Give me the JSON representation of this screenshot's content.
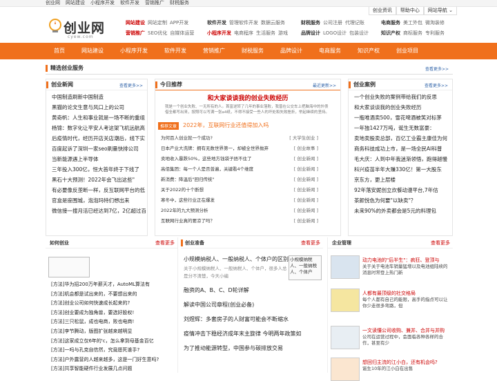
{
  "topbar": {
    "links": [
      "创业网",
      "网站建设",
      "小程序开发",
      "软件开发",
      "营销推广",
      "财税服务"
    ]
  },
  "topright": {
    "items": [
      "创业资讯",
      "帮助中心",
      "网站导航 ⌄"
    ]
  },
  "logo": {
    "text": "创业网",
    "sub": "cyew.com"
  },
  "navgrid": [
    {
      "rows": [
        {
          "hd": "网站建设",
          "subs": [
            "网站定制",
            "APP开发"
          ]
        },
        {
          "hd": "营销推广",
          "subs": [
            "SEO优化",
            "自媒体运营"
          ]
        }
      ]
    },
    {
      "rows": [
        {
          "hd": "软件开发",
          "subs": [
            "管理软件开发",
            "数据云服务"
          ]
        },
        {
          "hd": "小程序开发",
          "subs": [
            "电商程序",
            "生活服务",
            "游戏"
          ]
        }
      ]
    },
    {
      "rows": [
        {
          "hd": "财税服务",
          "subs": [
            "公司注册",
            "代理记账"
          ]
        },
        {
          "hd": "品牌设计",
          "subs": [
            "LOGO设计",
            "包装设计"
          ]
        }
      ]
    },
    {
      "rows": [
        {
          "hd": "电商服务",
          "subs": [
            "美工外包",
            "微淘装修"
          ]
        },
        {
          "hd": "知识产权",
          "subs": [
            "商标服务",
            "专利服务"
          ]
        }
      ]
    }
  ],
  "mainnav": [
    "首页",
    "网站建设",
    "小程序开发",
    "软件开发",
    "营销推广",
    "财税服务",
    "品牌设计",
    "电商服务",
    "知识产权",
    "创业项目"
  ],
  "section": {
    "title": "精选创业服务",
    "more": "查看更多>>"
  },
  "news": {
    "title": "创业新闻",
    "more": "查看更多>>",
    "items": [
      "中国制造刷新中国制造",
      "黑猫的论文生意与风口上的公司",
      "黄奇帆：人生和事业就是一场不断的重组",
      "杨锦：数字化让平安人考这架飞机远航高",
      "后疫情时代，经历开店关店潮后，线下实",
      "百度起诉了深圳一家seo刷量快排公司",
      "当新能源遇上半导体",
      "三年投入300亿，恒大首年终于下线了",
      "黑石十大预测！2022年会飞出这些\"",
      "有必要像反垄断一样，反互联网平台的低",
      "官盒是座围城，泡泡玛特们想出来",
      "微信接一搜月活已经达到7亿，2亿超过百"
    ]
  },
  "rec": {
    "title": "今日推荐",
    "more": "最近更新>>",
    "headline": "和大家谈谈我的创业失败经历",
    "desc": "我是一个创业失败、一无所有的人。首富逆转了几年的事业落败，我曾在公交车上把脑海中的外债借全都写出来，按照可以写满一张a4纸，不得不接受一些人的坏处和失败挫折，举起继续的坚持。",
    "tag": "推荐文章",
    "tagline": "2022年，互联网行业还值得加入吗",
    "items": [
      {
        "t": "为何百人创业就一个成功?",
        "c": "[ 大学生创业 ]"
      },
      {
        "t": "日本产业大洗牌：拥有无数世界第一，却被全世界抛弃",
        "c": "[ 创业故事 ]"
      },
      {
        "t": "卖地收入暴跌50%，这些地方钱袋子捂不住了",
        "c": "[ 创业新闻 ]"
      },
      {
        "t": "高佰集团：每一个人是否普遍，关键看4个维度",
        "c": "[ 创业新闻 ]"
      },
      {
        "t": "新消费：降温后\"回归传统\"",
        "c": "[ 创业新闻 ]"
      },
      {
        "t": "关于2022的十个断想",
        "c": "[ 创业新闻 ]"
      },
      {
        "t": "寒冬中，这些行业正在爆发",
        "c": "[ 创业新闻 ]"
      },
      {
        "t": "2022年的九大预测分析",
        "c": "[ 创业新闻 ]"
      },
      {
        "t": "互联网行业真的要凉了吗？",
        "c": "[ 创业新闻 ]"
      }
    ]
  },
  "cases": {
    "title": "创业案例",
    "more": "查看更多>>",
    "items": [
      "一个创业失败的案例带给我们的反思",
      "和大家谈谈我的创业失败经历",
      "一瓶唯酒卖500，雪花啤酒被笑对标茅",
      "一年独1427万吨，诞生无数富豪：",
      "卖地卖股卖总部，百亿工业霸主康佳为何",
      "商务科技成功上市，是一场全民AI科普",
      "毛大庆：人到中年我迷渐领悟，跑得越慢",
      "科兴疫苗半年大赚330亿！第一大股东",
      "京东方，更上层楼",
      "92年落安妮创立炊餐动漫平台,7年估",
      "茶颜悦色为何要\"以缺卖\"？",
      "未来90%的外卖都会是5元的料理包"
    ]
  },
  "howto": {
    "title": "如何创业",
    "more": "查看更多",
    "items": [
      "[方法]华为招200万年薪天才，AutoML算法有",
      "[方法]机会都是试出来的，不要想出来的",
      "[方法]创业公司如何快速成长起来的?",
      "[方法]创业要成为独角兽，要选好股权!",
      "[方法]三只松鼠，成也电商，败也电商!",
      "[方法]李节腾动，版图扩张越来越明显",
      "[方法]这家成立仅6年的'c，怎么拿到母基金百亿",
      "[方法]一吗与孔克自信然，究竟愿死谁手?",
      "[方法]户外露营的人越来越多，这是一门好生意吗?",
      "[方法]共享智能硬件行业发展几点问题"
    ]
  },
  "prep": {
    "title": "创业准备",
    "more": "查看更多",
    "headline": "小规模纳税人、一般纳税人、个体户的区别",
    "desc": "关于小规模纳税人、一般纳税人、个体户，很多人总是分不清楚，今天小编",
    "img_alt": "小规模纳税人、一般纳税人、个体户",
    "items": [
      "融资的A、B、C、D轮详解",
      "解读中国公司章程(创业必备)",
      "刘煜辉：多套房子的人财富可能会不断缩水",
      "疫情冲击下稳经济成年末主旋律 今明两年政策如",
      "为了推动能源转型，中国参与碳排放交易"
    ]
  },
  "corp": {
    "title": "企业管理",
    "more": "查看更多",
    "items": [
      {
        "title": "动力电池的\"后半生\"：疯狂、登顶与",
        "desc": "关于关于电池车销量猛增以及电池组陆续的消息时常登上热门新"
      },
      {
        "title": "人都有最顶级的社交格局",
        "desc": "每个人都有自己的能限，高手的指点可以让你少走很多弯路，但"
      },
      {
        "title": "一文读懂公司收购、兼并、合并与并购",
        "desc": "公司在运营过程中，会面临各种各样的合作，甚至有少"
      },
      {
        "title": "想回归主流的江小白，还有机会吗?",
        "desc": "诞生10年的江小白在出售"
      }
    ]
  }
}
